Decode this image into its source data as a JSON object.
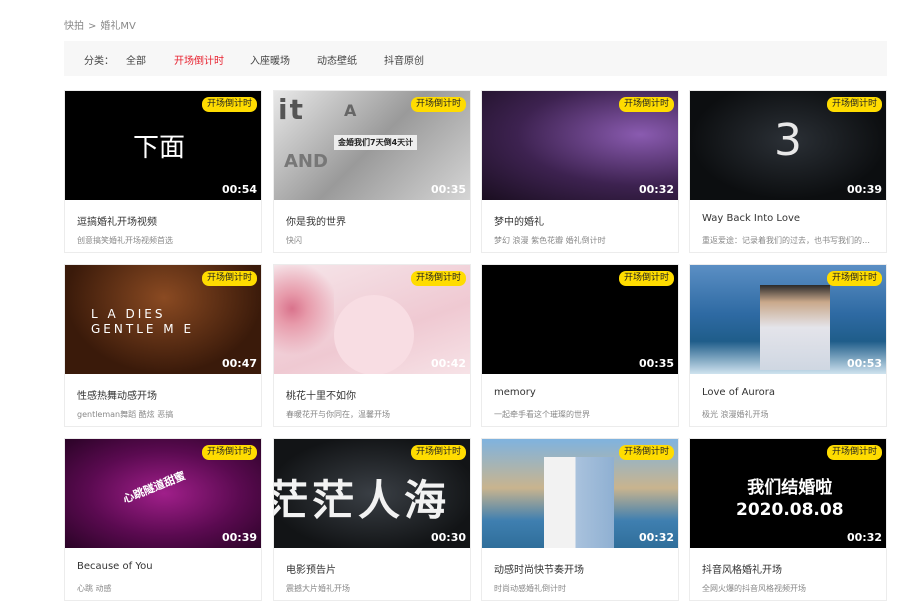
{
  "breadcrumb": {
    "home": "快拍",
    "sep": ">",
    "current": "婚礼MV"
  },
  "filter": {
    "label": "分类：",
    "options": [
      "全部",
      "开场倒计时",
      "入座暖场",
      "动态壁纸",
      "抖音原创"
    ],
    "active": 1
  },
  "badge": "开场倒计时",
  "cards": [
    {
      "title": "逗搞婚礼开场视频",
      "desc": "创意搞笑婚礼开场视频首选",
      "duration": "00:54",
      "thumb_text": "下面"
    },
    {
      "title": "你是我的世界",
      "desc": "快闪",
      "duration": "00:35",
      "thumb_text": "金婚我们7天倒4天计"
    },
    {
      "title": "梦中的婚礼",
      "desc": "梦幻 浪漫 紫色花瓣 婚礼倒计时",
      "duration": "00:32",
      "thumb_text": ""
    },
    {
      "title": "Way Back Into Love",
      "desc": "重返爱途：记录着我们的过去，也书写我们的…",
      "duration": "00:39",
      "thumb_text": "3"
    },
    {
      "title": "性感热舞动感开场",
      "desc": "gentleman舞蹈 酷炫 恶搞",
      "duration": "00:47",
      "thumb_text": "L A DIES\nGENTLE M E"
    },
    {
      "title": "桃花十里不如你",
      "desc": "春暖花开与你同在，温馨开场",
      "duration": "00:42",
      "thumb_text": ""
    },
    {
      "title": "memory",
      "desc": "一起牵手看这个璀璨的世界",
      "duration": "00:35",
      "thumb_text": ""
    },
    {
      "title": "Love of Aurora",
      "desc": "极光 浪漫婚礼开场",
      "duration": "00:53",
      "thumb_text": ""
    },
    {
      "title": "Because of You",
      "desc": "心跳 动感",
      "duration": "00:39",
      "thumb_text": "心跳隧道甜蜜"
    },
    {
      "title": "电影预告片",
      "desc": "震撼大片婚礼开场",
      "duration": "00:30",
      "thumb_text": "茫茫人海"
    },
    {
      "title": "动感时尚快节奏开场",
      "desc": "时尚动感婚礼倒计时",
      "duration": "00:32",
      "thumb_text": ""
    },
    {
      "title": "抖音风格婚礼开场",
      "desc": "全网火爆的抖音风格视频开场",
      "duration": "00:32",
      "thumb_text": "我们结婚啦\n2020.08.08"
    }
  ]
}
